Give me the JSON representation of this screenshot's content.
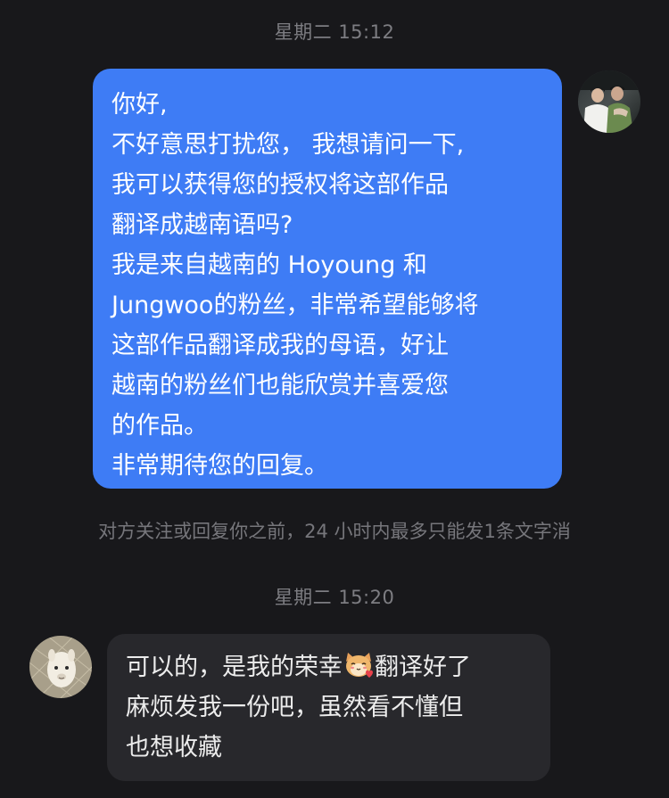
{
  "chat": {
    "timestamp_1": "星期二 15:12",
    "timestamp_2": "星期二 15:20",
    "notice": "对方关注或回复你之前，24 小时内最多只能发1条文字消",
    "outgoing_message": {
      "lines": [
        "你好,",
        "不好意思打扰您， 我想请问一下,",
        "我可以获得您的授权将这部作品",
        "翻译成越南语吗?",
        "我是来自越南的 Hoyoung 和",
        "Jungwoo的粉丝，非常希望能够将",
        "这部作品翻译成我的母语，好让",
        "越南的粉丝们也能欣赏并喜爱您",
        "的作品。",
        "非常期待您的回复。"
      ]
    },
    "incoming_message": {
      "line1_before_emoji": "可以的，是我的荣幸",
      "emoji": "cat-heart-emoji",
      "line1_after_emoji": "翻译好了",
      "line2": "麻烦发我一份吧，虽然看不懂但",
      "line3": "也想收藏"
    }
  },
  "colors": {
    "background": "#18181b",
    "outgoing_bubble": "#3e7cf5",
    "incoming_bubble": "#28282c",
    "meta_text": "#7d7d82"
  }
}
